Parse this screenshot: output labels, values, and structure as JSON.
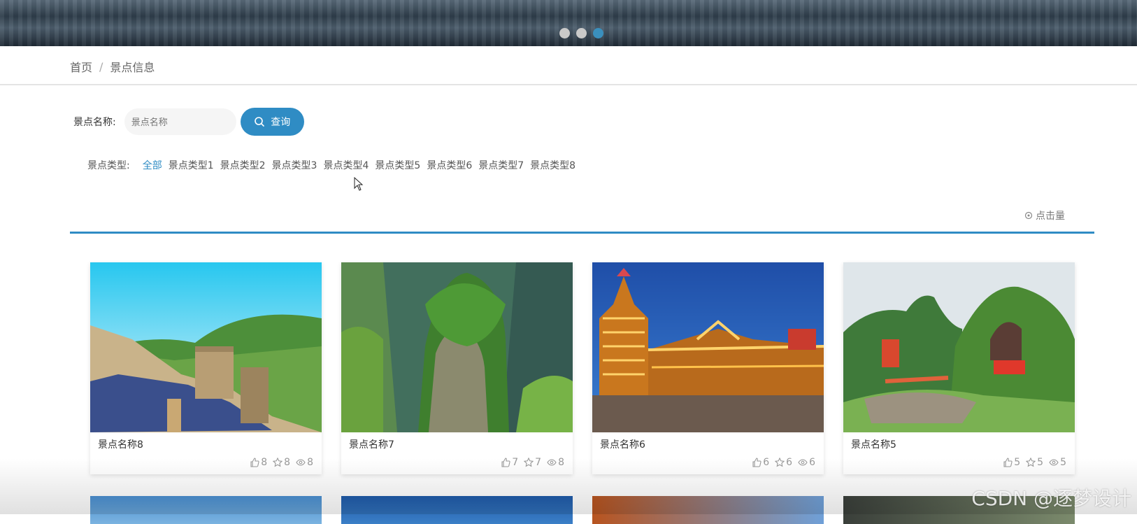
{
  "banner": {
    "slides": 3,
    "active_index": 2
  },
  "breadcrumb": {
    "home": "首页",
    "separator": "/",
    "current": "景点信息"
  },
  "search": {
    "label": "景点名称:",
    "placeholder": "景点名称",
    "button": "查询"
  },
  "types": {
    "label": "景点类型:",
    "items": [
      "全部",
      "景点类型1",
      "景点类型2",
      "景点类型3",
      "景点类型4",
      "景点类型5",
      "景点类型6",
      "景点类型7",
      "景点类型8"
    ],
    "active": "全部"
  },
  "sort": {
    "label": "点击量"
  },
  "cards": [
    {
      "name": "景点名称8",
      "likes": "8",
      "favorites": "8",
      "views": "8"
    },
    {
      "name": "景点名称7",
      "likes": "7",
      "favorites": "7",
      "views": "8"
    },
    {
      "name": "景点名称6",
      "likes": "6",
      "favorites": "6",
      "views": "6"
    },
    {
      "name": "景点名称5",
      "likes": "5",
      "favorites": "5",
      "views": "5"
    }
  ],
  "watermark": "CSDN @逐梦设计",
  "colors": {
    "accent": "#2f8cc4"
  }
}
